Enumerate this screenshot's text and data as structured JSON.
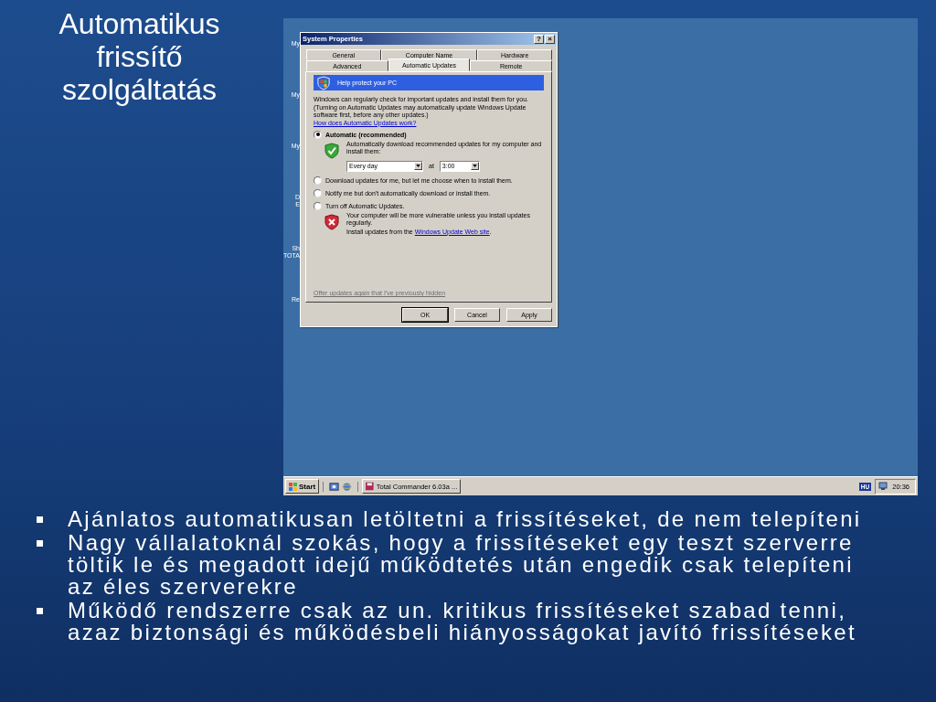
{
  "slide": {
    "title": "Automatikus frissítő szolgáltatás",
    "bullets": [
      "Ajánlatos automatikusan letöltetni a frissítéseket, de nem telepíteni",
      "Nagy vállalatoknál szokás, hogy a frissítéseket egy teszt szerverre töltik le és megadott idejű működtetés után engedik csak telepíteni az éles szerverekre",
      "Működő rendszerre csak az un. kritikus frissítéseket szabad tenni, azaz biztonsági és működésbeli hiányosságokat javító frissítéseket"
    ]
  },
  "desktop": {
    "icon_labels": [
      [
        "My"
      ],
      [
        "My"
      ],
      [
        "My"
      ],
      [
        "D",
        "E"
      ],
      [
        "Sh",
        "TOTA"
      ],
      [
        "Re"
      ]
    ]
  },
  "dialog": {
    "title": "System Properties",
    "help_button": "?",
    "close_button": "×",
    "tab_rows": [
      [
        {
          "label": "General",
          "selected": false
        },
        {
          "label": "Computer Name",
          "selected": false
        },
        {
          "label": "Hardware",
          "selected": false
        }
      ],
      [
        {
          "label": "Advanced",
          "selected": false
        },
        {
          "label": "Automatic Updates",
          "selected": true
        },
        {
          "label": "Remote",
          "selected": false
        }
      ]
    ],
    "banner": "Help protect your PC",
    "intro": "Windows can regularly check for important updates and install them for you. (Turning on Automatic Updates may automatically update Windows Update software first, before any other updates.)",
    "intro_link": "How does Automatic Updates work?",
    "options": [
      {
        "label": "Automatic (recommended)",
        "selected": true,
        "kind": "schedule",
        "description": "Automatically download recommended updates for my computer and install them:",
        "day": "Every day",
        "at": "at",
        "time": "3:00"
      },
      {
        "label": "Download updates for me, but let me choose when to install them.",
        "selected": false,
        "kind": "plain"
      },
      {
        "label": "Notify me but don't automatically download or install them.",
        "selected": false,
        "kind": "plain"
      },
      {
        "label": "Turn off Automatic Updates.",
        "selected": false,
        "kind": "warning",
        "description": "Your computer will be more vulnerable unless you install updates regularly.",
        "install_text": "Install updates from the ",
        "install_link": "Windows Update Web site",
        "install_end": "."
      }
    ],
    "hidden_link": {
      "label": "Offer updates again that I've previously hidden",
      "disabled": true
    },
    "buttons": [
      "OK",
      "Cancel",
      "Apply"
    ]
  },
  "taskbar": {
    "start": "Start",
    "task": "Total Commander 6.03a ...",
    "language": "HU",
    "clock": "20:36"
  }
}
